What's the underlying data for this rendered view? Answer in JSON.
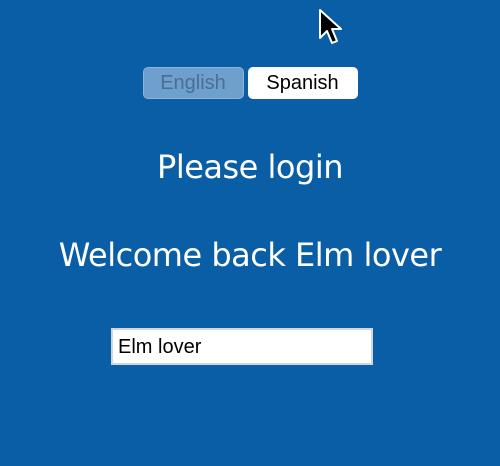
{
  "language_bar": {
    "english_label": "English",
    "spanish_label": "Spanish",
    "selected": "English"
  },
  "login": {
    "title": "Please login",
    "welcome_message": "Welcome back Elm lover"
  },
  "name_input": {
    "value": "Elm lover"
  },
  "colors": {
    "background": "#0a5ea5",
    "text": "#ffffff",
    "selected_button": "#6f9fcd"
  },
  "icons": {
    "cursor": "mouse-pointer-icon"
  }
}
